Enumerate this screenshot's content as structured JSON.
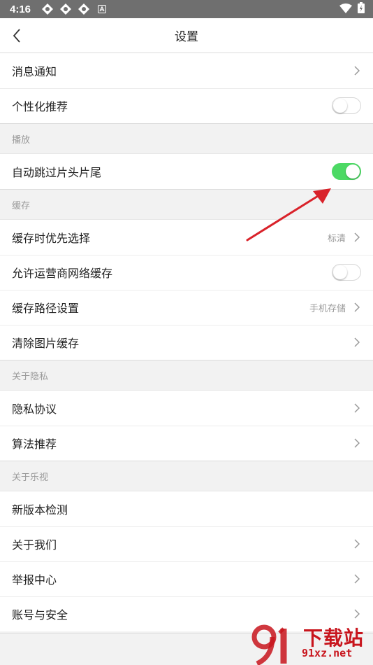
{
  "status_bar": {
    "time": "4:16"
  },
  "app_bar": {
    "title": "设置"
  },
  "groups": {
    "top": [
      {
        "label": "消息通知"
      },
      {
        "label": "个性化推荐"
      }
    ],
    "playback": {
      "header": "播放",
      "items": [
        {
          "label": "自动跳过片头片尾",
          "toggle": "on"
        }
      ]
    },
    "cache": {
      "header": "缓存",
      "items": [
        {
          "label": "缓存时优先选择",
          "value": "标清"
        },
        {
          "label": "允许运营商网络缓存",
          "toggle": "off"
        },
        {
          "label": "缓存路径设置",
          "value": "手机存储"
        },
        {
          "label": "清除图片缓存"
        }
      ]
    },
    "privacy": {
      "header": "关于隐私",
      "items": [
        {
          "label": "隐私协议"
        },
        {
          "label": "算法推荐"
        }
      ]
    },
    "about": {
      "header": "关于乐视",
      "items": [
        {
          "label": "新版本检测"
        },
        {
          "label": "关于我们"
        },
        {
          "label": "举报中心"
        },
        {
          "label": "账号与安全"
        }
      ]
    }
  },
  "watermark": {
    "title": "下载站",
    "url": "91xz.net"
  },
  "colors": {
    "toggle_on": "#4cd964",
    "annotation_arrow": "#d9222a",
    "watermark": "#c8151d"
  }
}
